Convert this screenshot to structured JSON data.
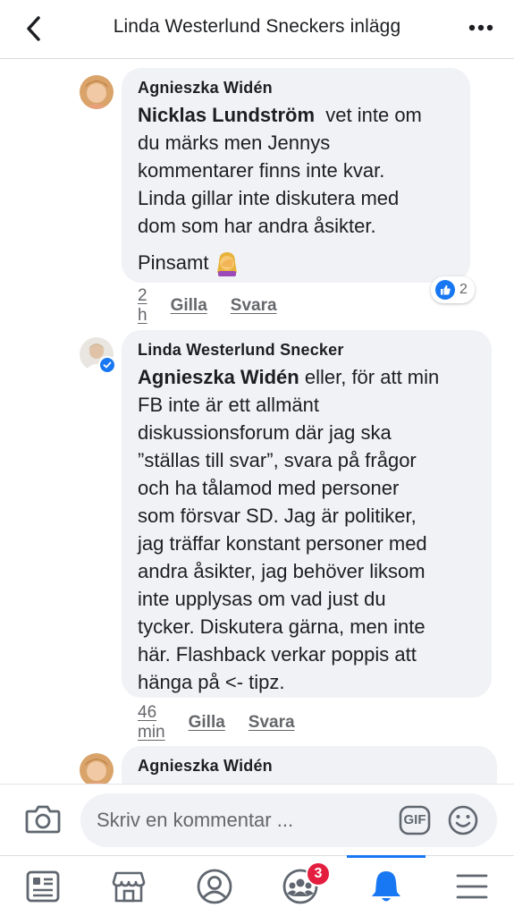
{
  "header": {
    "title": "Linda Westerlund Sneckers inlägg"
  },
  "comments": [
    {
      "author": "Agnieszka Widén",
      "mention": "Nicklas Lundström",
      "text_lines": [
        "vet inte om",
        "du märks men Jennys",
        "kommentarer finns inte kvar.",
        "Linda gillar inte diskutera med",
        "dom som har andra åsikter."
      ],
      "text2": "Pinsamt",
      "emoji": "🤦‍♀️",
      "time": "2 h",
      "like_label": "Gilla",
      "reply_label": "Svara",
      "reaction_count": "2"
    },
    {
      "author": "Linda Westerlund Snecker",
      "mention": "Agnieszka Widén",
      "text_lines": [
        "eller, för att min",
        "FB inte är ett allmänt",
        "diskussionsforum där jag ska",
        "”ställas till svar”, svara på frågor",
        "och ha tålamod med personer",
        "som försvar SD. Jag är politiker,",
        "jag träffar konstant personer med",
        "andra åsikter, jag behöver liksom",
        "inte upplysas om vad just du",
        "tycker. Diskutera gärna, men inte",
        "här. Flashback verkar poppis att",
        "hänga på <- tipz."
      ],
      "time": "46 min",
      "like_label": "Gilla",
      "reply_label": "Svara"
    },
    {
      "author": "Agnieszka Widén"
    }
  ],
  "composer": {
    "placeholder": "Skriv en kommentar ...",
    "gif_label": "GIF"
  },
  "bottom_nav": {
    "items": [
      "feed-icon",
      "marketplace-icon",
      "profile-icon",
      "groups-icon",
      "notifications-icon",
      "menu-icon"
    ],
    "groups_badge": "3",
    "active": "notifications-icon"
  },
  "colors": {
    "accent": "#1877f2",
    "bubble": "#f0f2f5",
    "badge": "#e41e3f",
    "meta_text": "#65676b"
  }
}
